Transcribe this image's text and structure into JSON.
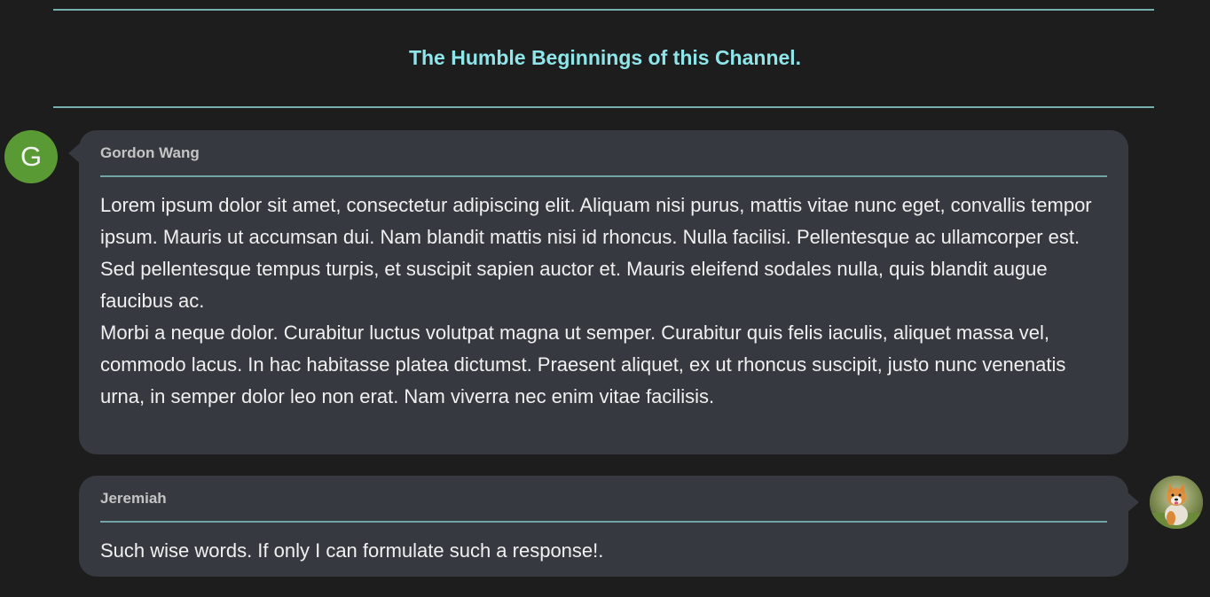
{
  "channel": {
    "title": "The Humble Beginnings of this Channel."
  },
  "messages": [
    {
      "author": "Gordon Wang",
      "avatar_letter": "G",
      "avatar_color": "#5a9a34",
      "side": "left",
      "paragraphs": [
        "Lorem ipsum dolor sit amet, consectetur adipiscing elit. Aliquam nisi purus, mattis vitae nunc eget, convallis tempor ipsum. Mauris ut accumsan dui. Nam blandit mattis nisi id rhoncus. Nulla facilisi. Pellentesque ac ullamcorper est. Sed pellentesque tempus turpis, et suscipit sapien auctor et. Mauris eleifend sodales nulla, quis blandit augue faucibus ac.",
        "Morbi a neque dolor. Curabitur luctus volutpat magna ut semper. Curabitur quis felis iaculis, aliquet massa vel, commodo lacus. In hac habitasse platea dictumst. Praesent aliquet, ex ut rhoncus suscipit, justo nunc venenatis urna, in semper dolor leo non erat. Nam viverra nec enim vitae facilisis."
      ]
    },
    {
      "author": "Jeremiah",
      "avatar_icon": "dog-photo-avatar",
      "side": "right",
      "paragraphs": [
        "Such wise words. If only I can formulate such a response!."
      ]
    }
  ],
  "colors": {
    "background": "#1d1d1d",
    "bubble": "#363940",
    "accent": "#8fe6ea",
    "rule": "#86c9c7"
  }
}
